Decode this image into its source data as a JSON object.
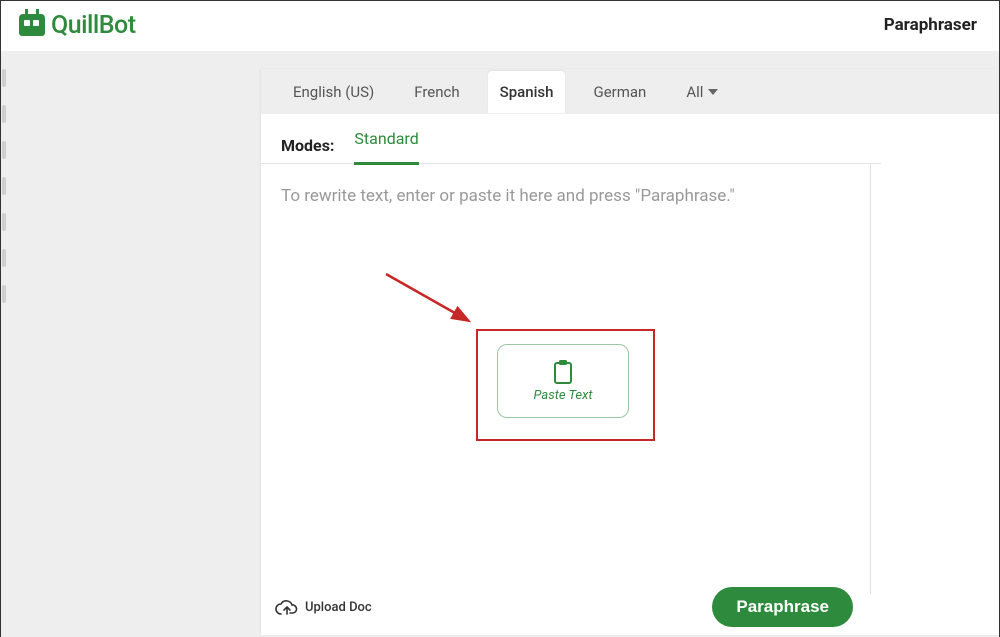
{
  "brand": {
    "name": "QuillBot"
  },
  "header": {
    "tool_title": "Paraphraser"
  },
  "languages": {
    "tabs": [
      "English (US)",
      "French",
      "Spanish",
      "German"
    ],
    "all_label": "All",
    "active_index": 2
  },
  "modes": {
    "label": "Modes:",
    "items": [
      "Standard"
    ],
    "active_index": 0
  },
  "editor": {
    "placeholder": "To rewrite text, enter or paste it here and press \"Paraphrase.\""
  },
  "paste_button": {
    "label": "Paste Text"
  },
  "upload": {
    "label": "Upload Doc"
  },
  "action": {
    "paraphrase_label": "Paraphrase"
  },
  "colors": {
    "brand_green": "#2e8b3d",
    "annotation_red": "#c62828",
    "bg_grey": "#eeeeee"
  }
}
